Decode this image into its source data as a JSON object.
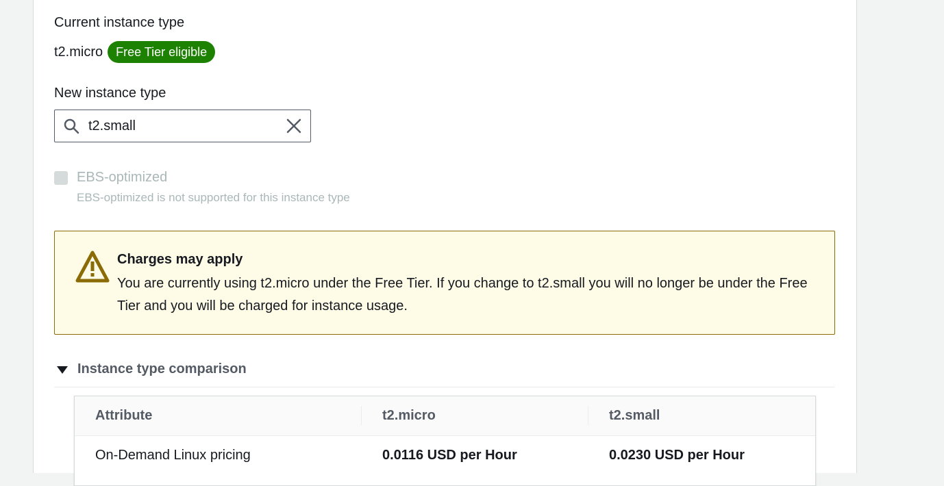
{
  "current": {
    "label": "Current instance type",
    "value": "t2.micro",
    "badge": "Free Tier eligible"
  },
  "new_type": {
    "label": "New instance type",
    "value": "t2.small"
  },
  "ebs": {
    "label": "EBS-optimized",
    "description": "EBS-optimized is not supported for this instance type",
    "checked": false
  },
  "alert": {
    "title": "Charges may apply",
    "body": "You are currently using t2.micro under the Free Tier. If you change to t2.small you will no longer be under the Free Tier and you will be charged for instance usage."
  },
  "comparison": {
    "title": "Instance type comparison",
    "headers": [
      "Attribute",
      "t2.micro",
      "t2.small"
    ],
    "rows": [
      [
        "On-Demand Linux pricing",
        "0.0116 USD per Hour",
        "0.0230 USD per Hour"
      ]
    ]
  },
  "colors": {
    "badge": "#1d8102",
    "alert_bg": "#fefbe6",
    "alert_border": "#8a6b05",
    "warning_icon": "#8a6b05"
  }
}
